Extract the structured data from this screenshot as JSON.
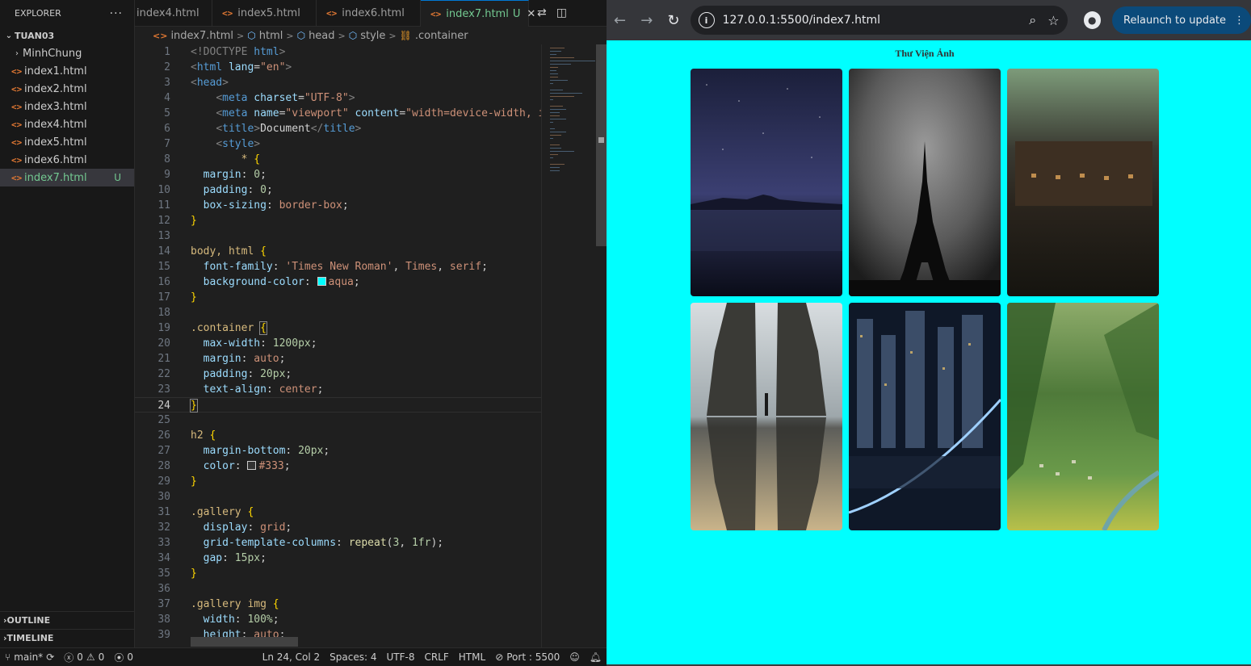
{
  "explorer": {
    "title": "EXPLORER",
    "more_icon": "more-icon",
    "folder": "TUAN03",
    "items": [
      {
        "label": "MinhChung",
        "type": "folder"
      },
      {
        "label": "index1.html",
        "type": "file"
      },
      {
        "label": "index2.html",
        "type": "file"
      },
      {
        "label": "index3.html",
        "type": "file"
      },
      {
        "label": "index4.html",
        "type": "file"
      },
      {
        "label": "index5.html",
        "type": "file"
      },
      {
        "label": "index6.html",
        "type": "file"
      },
      {
        "label": "index7.html",
        "type": "file",
        "badge": "U"
      }
    ],
    "outline": "OUTLINE",
    "timeline": "TIMELINE"
  },
  "tabs": [
    {
      "label": "index4.html"
    },
    {
      "label": "index5.html"
    },
    {
      "label": "index6.html"
    },
    {
      "label": "index7.html",
      "badge": "U",
      "active": true
    }
  ],
  "breadcrumb": [
    "index7.html",
    "html",
    "head",
    "style",
    ".container"
  ],
  "code": {
    "current_line": 24,
    "lines": [
      "1",
      "2",
      "3",
      "4",
      "5",
      "6",
      "7",
      "8",
      "9",
      "10",
      "11",
      "12",
      "13",
      "14",
      "15",
      "16",
      "17",
      "18",
      "19",
      "20",
      "21",
      "22",
      "23",
      "24",
      "25",
      "26",
      "27",
      "28",
      "29",
      "30",
      "31",
      "32",
      "33",
      "34",
      "35",
      "36",
      "37",
      "38",
      "39"
    ],
    "t": {
      "doctype_a": "<!DOCTYPE ",
      "doctype_b": "html",
      "doctype_c": ">",
      "html_open": "html",
      "lang_attr": "lang",
      "lang_val": "\"en\"",
      "head": "head",
      "meta": "meta",
      "charset": "charset",
      "utf8": "\"UTF-8\"",
      "name_attr": "name",
      "viewport": "\"viewport\"",
      "content_attr": "content",
      "content_val": "\"width=device-width, in",
      "title": "title",
      "title_text": "Document",
      "style": "style",
      "star": "* ",
      "margin": "margin",
      "padding": "padding",
      "box_sizing": "box-sizing",
      "border_box": "border-box",
      "zero": "0",
      "body_html": "body, html ",
      "font_family": "font-family",
      "ff_a": "'Times New Roman'",
      "ff_b": "Times",
      "ff_c": "serif",
      "bg_color": "background-color",
      "aqua": "aqua",
      "container": ".container ",
      "max_width": "max-width",
      "px1200": "1200px",
      "auto": "auto",
      "px20": "20px",
      "text_align": "text-align",
      "center": "center",
      "h2": "h2 ",
      "margin_bottom": "margin-bottom",
      "color": "color",
      "hex333": "#333",
      "gallery": ".gallery ",
      "display": "display",
      "grid": "grid",
      "gtc": "grid-template-columns",
      "repeat": "repeat",
      "three": "3",
      "fr": "1fr",
      "gap": "gap",
      "px15": "15px",
      "gallery_img": ".gallery img ",
      "width": "width",
      "pct100": "100%",
      "height": "height"
    }
  },
  "statusbar": {
    "branch": "main*",
    "errors": "0",
    "warnings": "0",
    "ports": "0",
    "position": "Ln 24, Col 2",
    "spaces": "Spaces: 4",
    "encoding": "UTF-8",
    "eol": "CRLF",
    "language": "HTML",
    "port": "Port : 5500"
  },
  "browser": {
    "url": "127.0.0.1:5500/index7.html",
    "relaunch": "Relaunch to update",
    "page_title": "Thư Viện Ảnh",
    "images": [
      {
        "name": "night-lake-image",
        "palette": [
          "#1b1f3a",
          "#3b3f72",
          "#2c3052",
          "#0a0c18"
        ]
      },
      {
        "name": "eiffel-tower-image",
        "palette": [
          "#1c1c1c",
          "#9a9a9a",
          "#5a5a5a",
          "#0b0b0b"
        ]
      },
      {
        "name": "stilt-village-image",
        "palette": [
          "#7d9b7a",
          "#3a3a32",
          "#2a241d",
          "#15140f"
        ]
      },
      {
        "name": "temple-gate-image",
        "palette": [
          "#d8dde0",
          "#9ea7ab",
          "#5d5e5a",
          "#c9b48a"
        ]
      },
      {
        "name": "city-night-image",
        "palette": [
          "#0f1828",
          "#3b4d68",
          "#1a2336",
          "#27344a"
        ]
      },
      {
        "name": "green-valley-image",
        "palette": [
          "#8dab6a",
          "#4f7a3a",
          "#6a9a4a",
          "#b8c04a"
        ]
      }
    ]
  }
}
